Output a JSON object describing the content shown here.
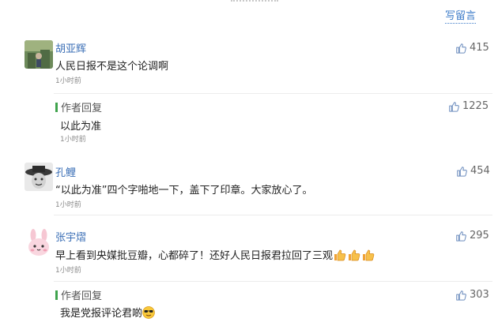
{
  "header": {
    "write_label": "写留言"
  },
  "comments": [
    {
      "user": "胡亚辉",
      "text": "人民日报不是这个论调啊",
      "time": "1小时前",
      "likes": "415",
      "reply": {
        "label": "作者回复",
        "text": "以此为准",
        "time": "1小时前",
        "likes": "1225"
      }
    },
    {
      "user": "孔鲤",
      "text": "“以此为准”四个字啪地一下，盖下了印章。大家放心了。",
      "time": "1小时前",
      "likes": "454"
    },
    {
      "user": "张宇熠",
      "text": "早上看到央媒批豆瓣，心都碎了！还好人民日报君拉回了三观",
      "time": "1小时前",
      "likes": "295",
      "emoji": [
        "thumbs-up",
        "thumbs-up",
        "thumbs-up"
      ],
      "reply": {
        "label": "作者回复",
        "text": "我是党报评论君啲",
        "likes": "303",
        "emoji": "sunglasses-face"
      }
    }
  ],
  "colors": {
    "link": "#3b6fb6",
    "reply_bar": "#3fa34d",
    "time": "#8a8a8a"
  }
}
